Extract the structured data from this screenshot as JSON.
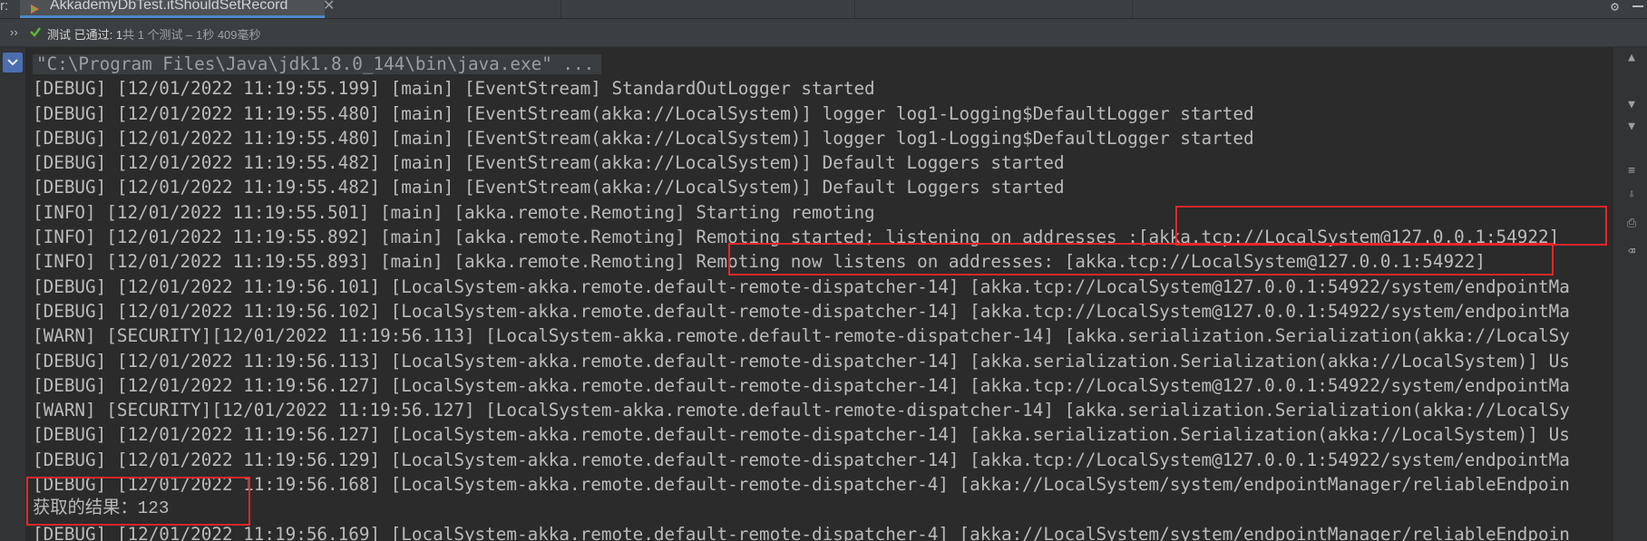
{
  "tabbar": {
    "prefix": "r:",
    "active_tab_title": "AkkademyDbTest.itShouldSetRecord",
    "close_glyph": "✕"
  },
  "status": {
    "passed_label": "测试 已通过: 1",
    "detail": "共 1 个测试 – 1秒 409毫秒"
  },
  "console": {
    "lines": [
      "\"C:\\Program Files\\Java\\jdk1.8.0_144\\bin\\java.exe\" ...",
      "[DEBUG] [12/01/2022 11:19:55.199] [main] [EventStream] StandardOutLogger started",
      "[DEBUG] [12/01/2022 11:19:55.480] [main] [EventStream(akka://LocalSystem)] logger log1-Logging$DefaultLogger started",
      "[DEBUG] [12/01/2022 11:19:55.480] [main] [EventStream(akka://LocalSystem)] logger log1-Logging$DefaultLogger started",
      "[DEBUG] [12/01/2022 11:19:55.482] [main] [EventStream(akka://LocalSystem)] Default Loggers started",
      "[DEBUG] [12/01/2022 11:19:55.482] [main] [EventStream(akka://LocalSystem)] Default Loggers started",
      "[INFO] [12/01/2022 11:19:55.501] [main] [akka.remote.Remoting] Starting remoting",
      "[INFO] [12/01/2022 11:19:55.892] [main] [akka.remote.Remoting] Remoting started; listening on addresses :[akka.tcp://LocalSystem@127.0.0.1:54922]",
      "[INFO] [12/01/2022 11:19:55.893] [main] [akka.remote.Remoting] Remoting now listens on addresses: [akka.tcp://LocalSystem@127.0.0.1:54922]",
      "[DEBUG] [12/01/2022 11:19:56.101] [LocalSystem-akka.remote.default-remote-dispatcher-14] [akka.tcp://LocalSystem@127.0.0.1:54922/system/endpointMa",
      "[DEBUG] [12/01/2022 11:19:56.102] [LocalSystem-akka.remote.default-remote-dispatcher-14] [akka.tcp://LocalSystem@127.0.0.1:54922/system/endpointMa",
      "[WARN] [SECURITY][12/01/2022 11:19:56.113] [LocalSystem-akka.remote.default-remote-dispatcher-14] [akka.serialization.Serialization(akka://LocalSy",
      "[DEBUG] [12/01/2022 11:19:56.113] [LocalSystem-akka.remote.default-remote-dispatcher-14] [akka.serialization.Serialization(akka://LocalSystem)] Us",
      "[DEBUG] [12/01/2022 11:19:56.127] [LocalSystem-akka.remote.default-remote-dispatcher-14] [akka.tcp://LocalSystem@127.0.0.1:54922/system/endpointMa",
      "[WARN] [SECURITY][12/01/2022 11:19:56.127] [LocalSystem-akka.remote.default-remote-dispatcher-14] [akka.serialization.Serialization(akka://LocalSy",
      "[DEBUG] [12/01/2022 11:19:56.127] [LocalSystem-akka.remote.default-remote-dispatcher-14] [akka.serialization.Serialization(akka://LocalSystem)] Us",
      "[DEBUG] [12/01/2022 11:19:56.129] [LocalSystem-akka.remote.default-remote-dispatcher-14] [akka.tcp://LocalSystem@127.0.0.1:54922/system/endpointMa",
      "[DEBUG] [12/01/2022 11:19:56.168] [LocalSystem-akka.remote.default-remote-dispatcher-4] [akka://LocalSystem/system/endpointManager/reliableEndpoin",
      "获取的结果：123",
      "[DEBUG] [12/01/2022 11:19:56.169] [LocalSystem-akka.remote.default-remote-dispatcher-4] [akka://LocalSystem/system/endpointManager/reliableEndpoin"
    ]
  },
  "colors": {
    "background": "#2b2b2b",
    "text": "#bbbbbb",
    "highlight": "#e8262a",
    "pass_green": "#5fb832",
    "accent_blue": "#4b6eaf"
  },
  "icons": [
    "run-config-icon",
    "close-icon",
    "settings-gear-icon",
    "minimize-icon",
    "expand-icon",
    "pass-check-icon",
    "collapse-chevron-icon",
    "scroll-up-icon",
    "scroll-down-icon",
    "soft-wrap-icon",
    "scroll-to-end-icon",
    "print-icon",
    "clear-icon"
  ]
}
